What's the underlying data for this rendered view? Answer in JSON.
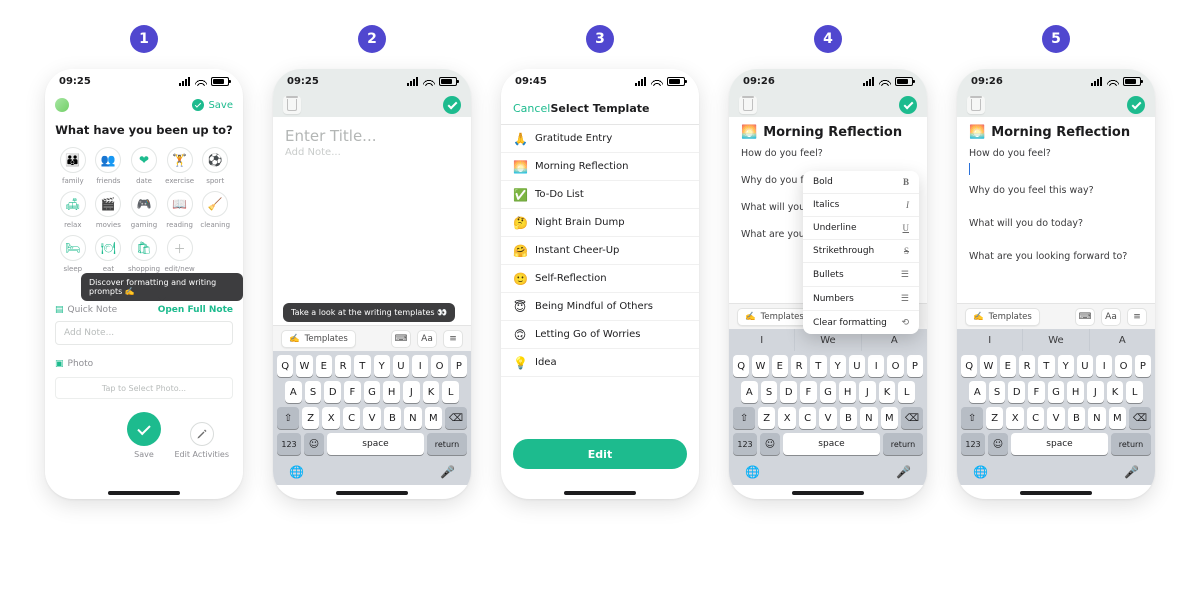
{
  "steps": [
    "1",
    "2",
    "3",
    "4",
    "5"
  ],
  "status": {
    "t_0925": "09:25",
    "t_0945": "09:45",
    "t_0926": "09:26"
  },
  "s1": {
    "save": "Save",
    "heading": "What have you been up to?",
    "icons": [
      {
        "l": "family"
      },
      {
        "l": "friends"
      },
      {
        "l": "date"
      },
      {
        "l": "exercise"
      },
      {
        "l": "sport"
      },
      {
        "l": "relax"
      },
      {
        "l": "movies"
      },
      {
        "l": "gaming"
      },
      {
        "l": "reading"
      },
      {
        "l": "cleaning"
      },
      {
        "l": "sleep"
      },
      {
        "l": "eat"
      },
      {
        "l": "shopping"
      },
      {
        "l": "edit/new"
      }
    ],
    "tip": "Discover formatting and writing prompts ✍️",
    "quick": "Quick Note",
    "open": "Open Full Note",
    "add": "Add Note...",
    "photo": "Photo",
    "tap_photo": "Tap to Select Photo...",
    "save_btn": "Save",
    "edit_activities": "Edit Activities"
  },
  "s2": {
    "title_ph": "Enter Title...",
    "addnote_ph": "Add Note...",
    "templates": "Templates",
    "tip": "Take a look at the writing templates 👀"
  },
  "keyboard": {
    "suggest": [
      "I",
      "We",
      "A"
    ],
    "rows": [
      [
        "Q",
        "W",
        "E",
        "R",
        "T",
        "Y",
        "U",
        "I",
        "O",
        "P"
      ],
      [
        "A",
        "S",
        "D",
        "F",
        "G",
        "H",
        "J",
        "K",
        "L"
      ],
      [
        "Z",
        "X",
        "C",
        "V",
        "B",
        "N",
        "M"
      ]
    ],
    "num": "123",
    "space": "space",
    "ret": "return"
  },
  "s3": {
    "cancel": "Cancel",
    "title": "Select Template",
    "items": [
      {
        "e": "🙏",
        "t": "Gratitude Entry"
      },
      {
        "e": "🌅",
        "t": "Morning Reflection"
      },
      {
        "e": "✅",
        "t": "To-Do List"
      },
      {
        "e": "🤔",
        "t": "Night Brain Dump"
      },
      {
        "e": "🤗",
        "t": "Instant Cheer-Up"
      },
      {
        "e": "🙂",
        "t": "Self-Reflection"
      },
      {
        "e": "😇",
        "t": "Being Mindful of Others"
      },
      {
        "e": "🙃",
        "t": "Letting Go of Worries"
      },
      {
        "e": "💡",
        "t": "Idea"
      }
    ],
    "edit": "Edit"
  },
  "s45": {
    "icon": "🌅",
    "title": "Morning Reflection",
    "prompts": [
      "How do you feel?",
      "Why do you feel this way?",
      "What will you do today?",
      "What are you looking forward to?"
    ],
    "p_trunc": [
      "How do you feel?",
      "Why do you feel",
      "What will you do",
      "What are you loo"
    ]
  },
  "fmt": {
    "items": [
      {
        "l": "Bold",
        "g": "B"
      },
      {
        "l": "Italics",
        "g": "I"
      },
      {
        "l": "Underline",
        "g": "U"
      },
      {
        "l": "Strikethrough",
        "g": "S"
      },
      {
        "l": "Bullets",
        "g": "≡"
      },
      {
        "l": "Numbers",
        "g": "≡"
      },
      {
        "l": "Clear formatting",
        "g": "⟲"
      }
    ]
  },
  "templ_bar": {
    "label": "Templates",
    "aa": "Aa"
  }
}
